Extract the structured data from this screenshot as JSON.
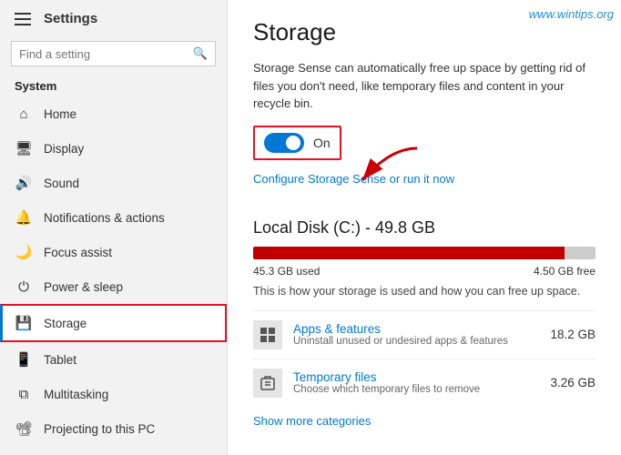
{
  "app": {
    "title": "Settings",
    "watermark": "www.wintips.org"
  },
  "sidebar": {
    "search_placeholder": "Find a setting",
    "section_label": "System",
    "items": [
      {
        "id": "home",
        "label": "Home",
        "icon": "⌂"
      },
      {
        "id": "display",
        "label": "Display",
        "icon": "🖥"
      },
      {
        "id": "sound",
        "label": "Sound",
        "icon": "🔊"
      },
      {
        "id": "notifications",
        "label": "Notifications & actions",
        "icon": "🔔"
      },
      {
        "id": "focus",
        "label": "Focus assist",
        "icon": "🌙"
      },
      {
        "id": "power",
        "label": "Power & sleep",
        "icon": "⏻"
      },
      {
        "id": "storage",
        "label": "Storage",
        "icon": "💾",
        "active": true
      },
      {
        "id": "tablet",
        "label": "Tablet",
        "icon": "📱"
      },
      {
        "id": "multitasking",
        "label": "Multitasking",
        "icon": "⧉"
      },
      {
        "id": "projecting",
        "label": "Projecting to this PC",
        "icon": "📽"
      }
    ]
  },
  "main": {
    "page_title": "Storage",
    "storage_sense_desc": "Storage Sense can automatically free up space by getting rid of files you don't need, like temporary files and content in your recycle bin.",
    "toggle_state": "On",
    "configure_link": "Configure Storage Sense or run it now",
    "disk": {
      "title": "Local Disk (C:) - 49.8 GB",
      "used_label": "45.3 GB used",
      "free_label": "4.50 GB free",
      "used_percent": 91,
      "usage_desc": "This is how your storage is used and how you can free up space."
    },
    "storage_items": [
      {
        "id": "apps",
        "icon": "📦",
        "title": "Apps & features",
        "subtitle": "Uninstall unused or undesired apps & features",
        "size": "18.2 GB"
      },
      {
        "id": "temp",
        "icon": "🗑",
        "title": "Temporary files",
        "subtitle": "Choose which temporary files to remove",
        "size": "3.26 GB"
      }
    ],
    "show_more_label": "Show more categories"
  }
}
